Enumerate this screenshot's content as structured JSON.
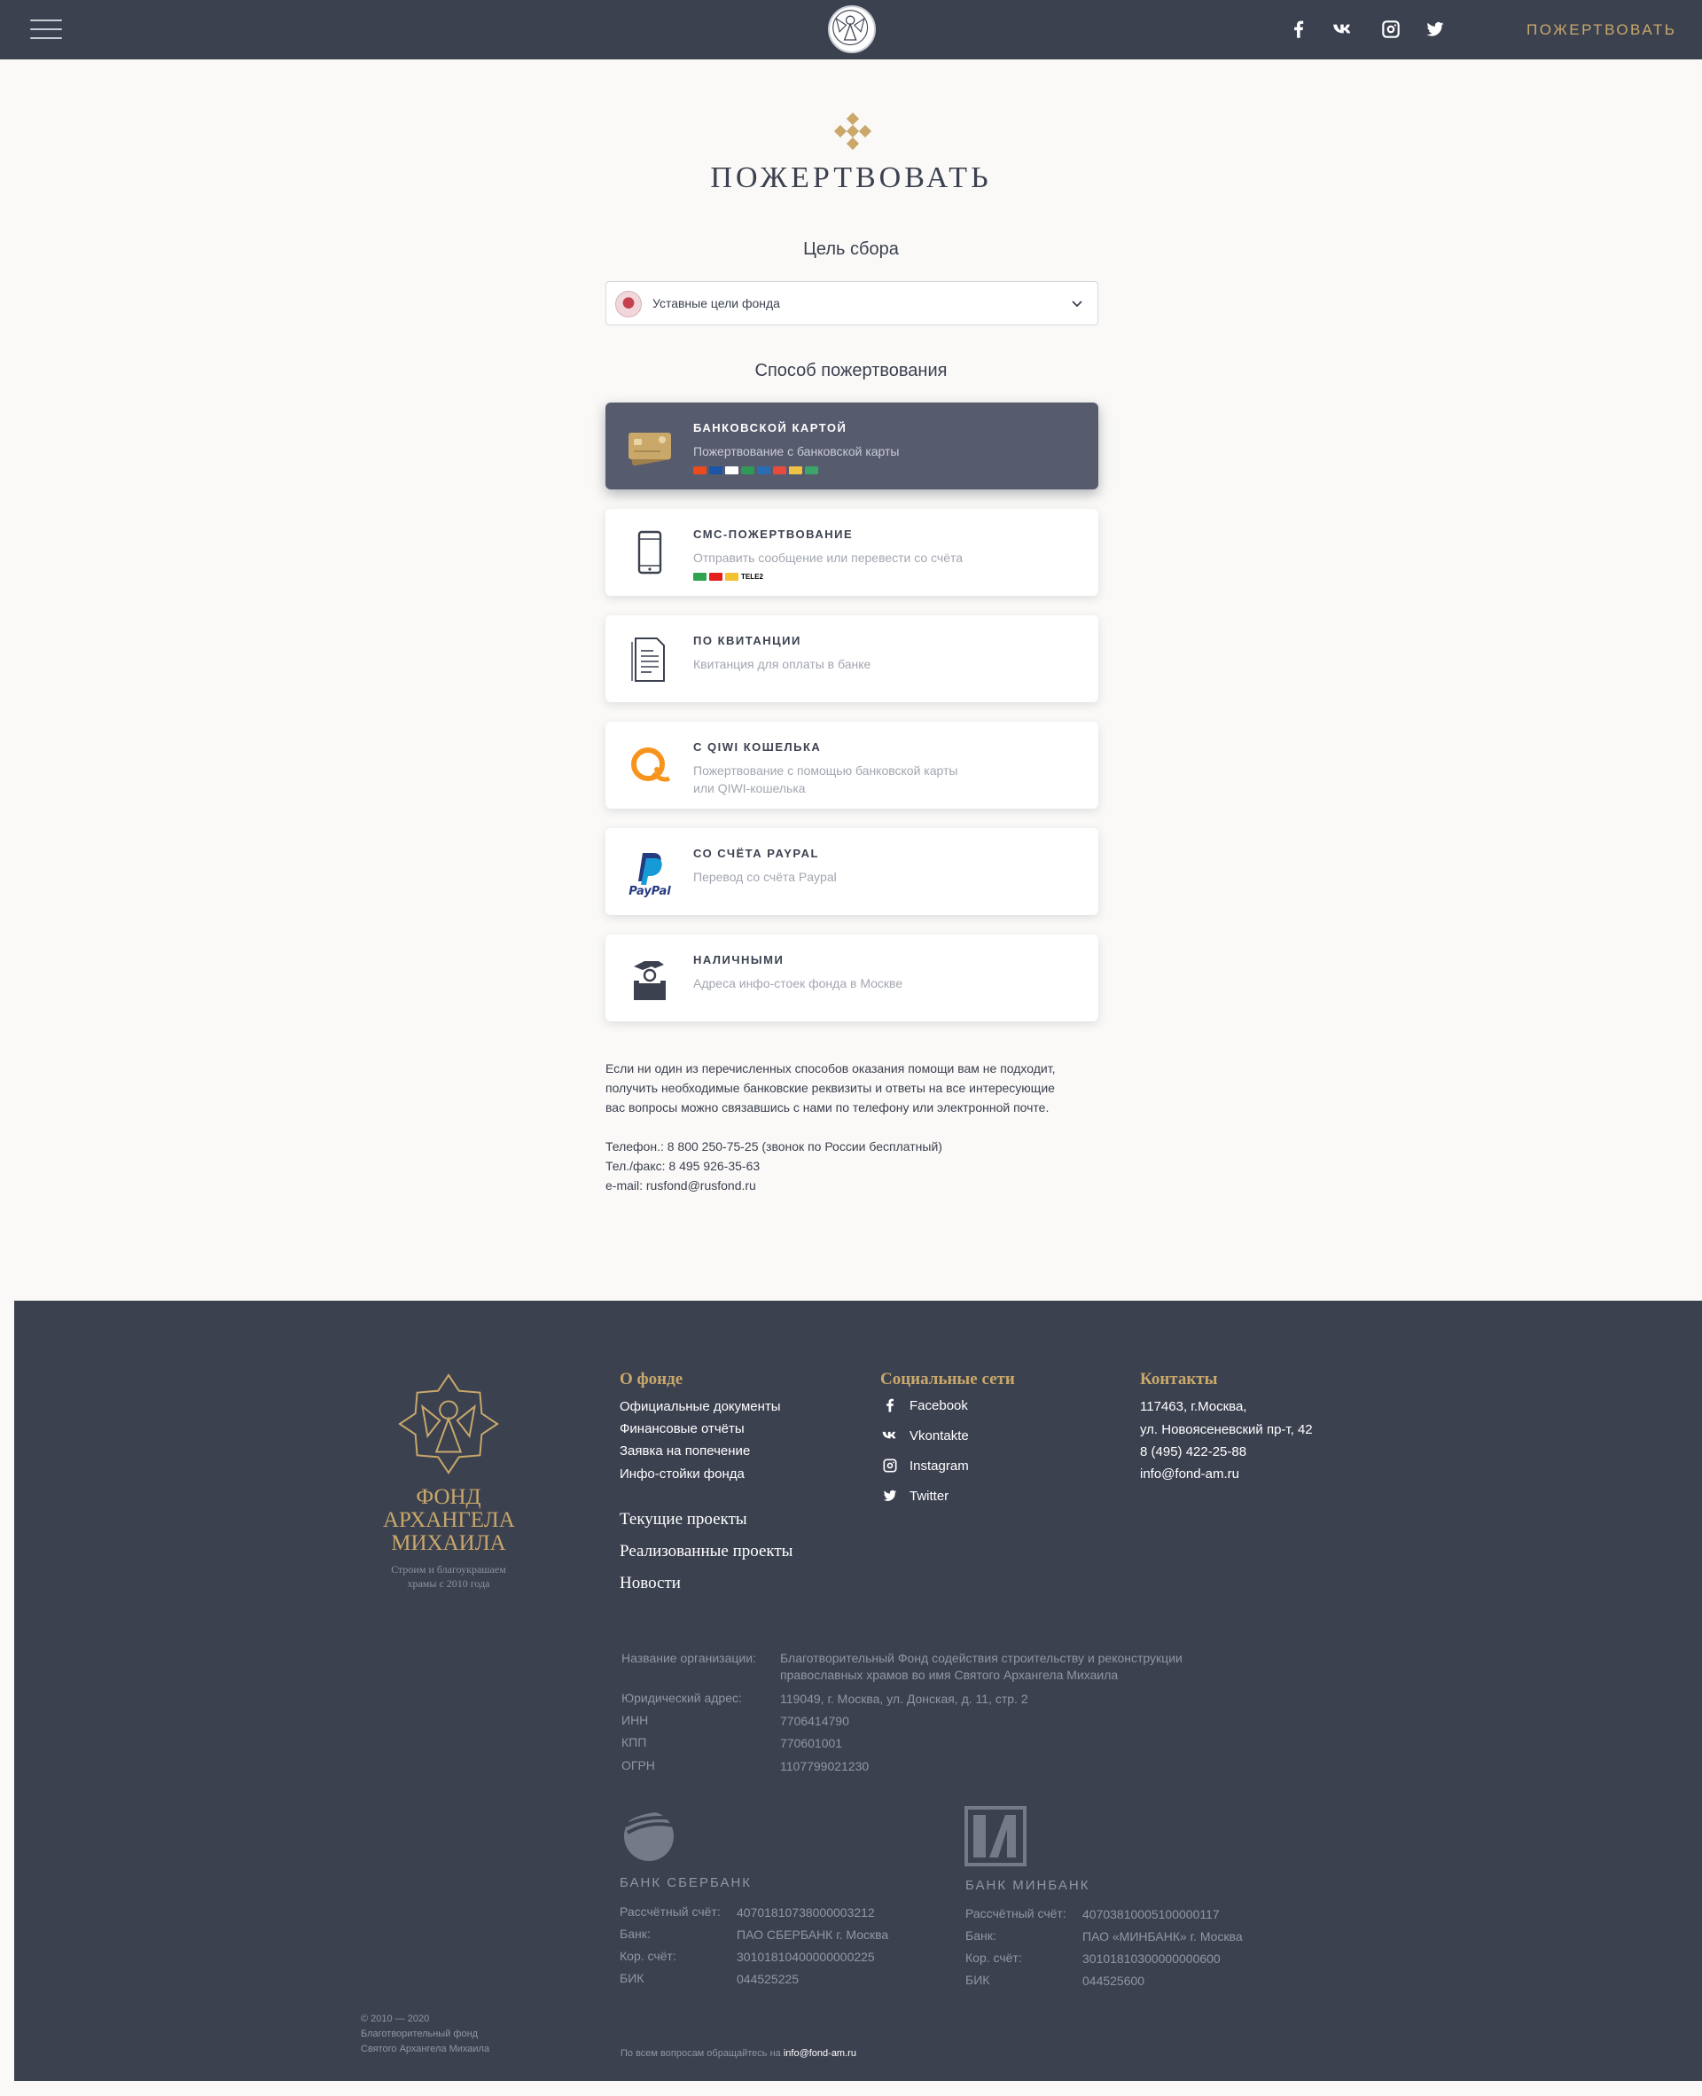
{
  "header": {
    "donate_label": "ПОЖЕРТВОВАТЬ",
    "social_icons": [
      "facebook-icon",
      "vk-icon",
      "instagram-icon",
      "twitter-icon"
    ]
  },
  "main": {
    "title": "ПОЖЕРТВОВАТЬ",
    "goal_heading": "Цель сбора",
    "goal_selected": "Уставные цели фонда",
    "method_heading": "Способ пожертвования",
    "methods": [
      {
        "title": "БАНКОВСКОЙ КАРТОЙ",
        "desc": "Пожертвование с банковской карты"
      },
      {
        "title": "СМС-ПОЖЕРТВОВАНИЕ",
        "desc": "Отправить сообщение или перевести со счёта"
      },
      {
        "title": "ПО КВИТАНЦИИ",
        "desc": "Квитанция для оплаты в банке"
      },
      {
        "title": "С QIWI КОШЕЛЬКА",
        "desc": "Пожертвование с помощью банковской карты",
        "desc2": "или QIWI-кошелька"
      },
      {
        "title": "СО СЧЁТА PAYPAL",
        "desc": "Перевод со счёта Paypal"
      },
      {
        "title": "НАЛИЧНЫМИ",
        "desc": "Адреса инфо-стоек фонда в Москве"
      }
    ],
    "paypal_logo": "PayPal",
    "sms_badge": "TELE2",
    "info": [
      "Если ни один из перечисленных способов оказания помощи вам не подходит,",
      "получить необходимые банковские реквизиты и ответы на все интересующие",
      "вас вопросы можно связавшись с нами по телефону или электронной почте.",
      "",
      "Телефон.: 8 800 250-75-25 (звонок по России бесплатный)",
      "Тел./факс: 8 495 926-35-63",
      "e-mail: rusfond@rusfond.ru"
    ],
    "colors": {
      "accent": "#c9a86a",
      "dark": "#3c4150",
      "active_card": "#575b6e"
    }
  },
  "footer": {
    "logo_lines": [
      "ФОНД",
      "АРХАНГЕЛА",
      "МИХАИЛА"
    ],
    "slogan_lines": [
      "Строим и благоукрашаем",
      "храмы с 2010 года"
    ],
    "about_title": "О фонде",
    "about_links": [
      "Официальные документы",
      "Финансовые отчёты",
      "Заявка на попечение",
      "Инфо-стойки фонда"
    ],
    "big_links": [
      "Текущие проекты",
      "Реализованные проекты",
      "Новости"
    ],
    "social_title": "Социальные сети",
    "social_links": [
      "Facebook",
      "Vkontakte",
      "Instagram",
      "Twitter"
    ],
    "contacts_title": "Контакты",
    "contacts": [
      "117463, г.Москва,",
      "ул. Новоясеневский пр-т, 42",
      "8 (495) 422-25-88",
      "info@fond-am.ru"
    ],
    "org": {
      "name_label": "Название организации:",
      "name_line1": "Благотворительный Фонд содействия строительству и реконструкции",
      "name_line2": "православных храмов во имя Святого Архангела Михаила",
      "address_label": "Юридический адрес:",
      "address": "119049, г. Москва, ул. Донская, д. 11, стр. 2",
      "inn_label": "ИНН",
      "inn": "7706414790",
      "kpp_label": "КПП",
      "kpp": "770601001",
      "ogrn_label": "ОГРН",
      "ogrn": "1107799021230"
    },
    "banks": [
      {
        "title": "БАНК СБЕРБАНК",
        "account_label": "Рассчётный счёт:",
        "account": "40701810738000003212",
        "bank_label": "Банк:",
        "bank": "ПАО СБЕРБАНК г. Москва",
        "kor_label": "Кор. счёт:",
        "kor": "30101810400000000225",
        "bik_label": "БИК",
        "bik": "044525225"
      },
      {
        "title": "БАНК МИНБАНК",
        "account_label": "Рассчётный счёт:",
        "account": "40703810005100000117",
        "bank_label": "Банк:",
        "bank": "ПАО «МИНБАНК» г. Москва",
        "kor_label": "Кор. счёт:",
        "kor": "30101810300000000600",
        "bik_label": "БИК",
        "bik": "044525600"
      }
    ],
    "copyright": [
      "© 2010 — 2020",
      "Благотворительный фонд",
      "Святого Архангела Михаила"
    ],
    "bottom_text": "По всем вопросам обращайтесь на",
    "bottom_email": "info@fond-am.ru"
  }
}
